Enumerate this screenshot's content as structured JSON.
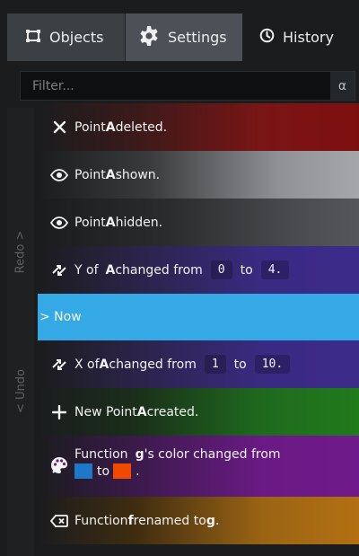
{
  "tabs": [
    {
      "label": "Objects",
      "icon": "objects-icon"
    },
    {
      "label": "Settings",
      "icon": "gear-icon"
    },
    {
      "label": "History",
      "icon": "clock-icon"
    }
  ],
  "filter": {
    "placeholder": "Filter...",
    "alpha_label": "α"
  },
  "side_labels": {
    "redo": "Redo >",
    "undo": "< Undo"
  },
  "history": [
    {
      "icon": "close-icon",
      "pre": "Point ",
      "name": "A",
      "post": " deleted."
    },
    {
      "icon": "eye-icon",
      "pre": "Point ",
      "name": "A",
      "post": " shown."
    },
    {
      "icon": "eye-icon",
      "pre": "Point ",
      "name": "A",
      "post": " hidden."
    },
    {
      "icon": "move-icon",
      "pre": "Y of ",
      "name": "A",
      "mid": " changed from ",
      "from": "0",
      "to_word": "to",
      "to": "4."
    },
    {
      "icon": "",
      "label": "> Now"
    },
    {
      "icon": "move-icon",
      "pre": "X of ",
      "name": "A",
      "mid": " changed from ",
      "from": "1",
      "to_word": "to",
      "to": "10."
    },
    {
      "icon": "plus-icon",
      "pre": "New Point ",
      "name": "A",
      "post": " created."
    },
    {
      "icon": "palette-icon",
      "pre": "Function ",
      "name": "g",
      "post": "'s color changed from",
      "to_word": "to",
      "from_color": "#1e78c8",
      "to_color": "#f14a00"
    },
    {
      "icon": "rename-icon",
      "pre": "Function ",
      "name": "f",
      "post": " renamed to ",
      "new_name": "g",
      "end": "."
    }
  ],
  "colors": {
    "now_highlight": "#35a8e6",
    "deleted": "#7e0f0f",
    "shown": "#a5a7aa",
    "changed": "#3d2b8a",
    "created": "#217a1c",
    "color_changed": "#6f1a8a",
    "renamed": "#b37012"
  }
}
